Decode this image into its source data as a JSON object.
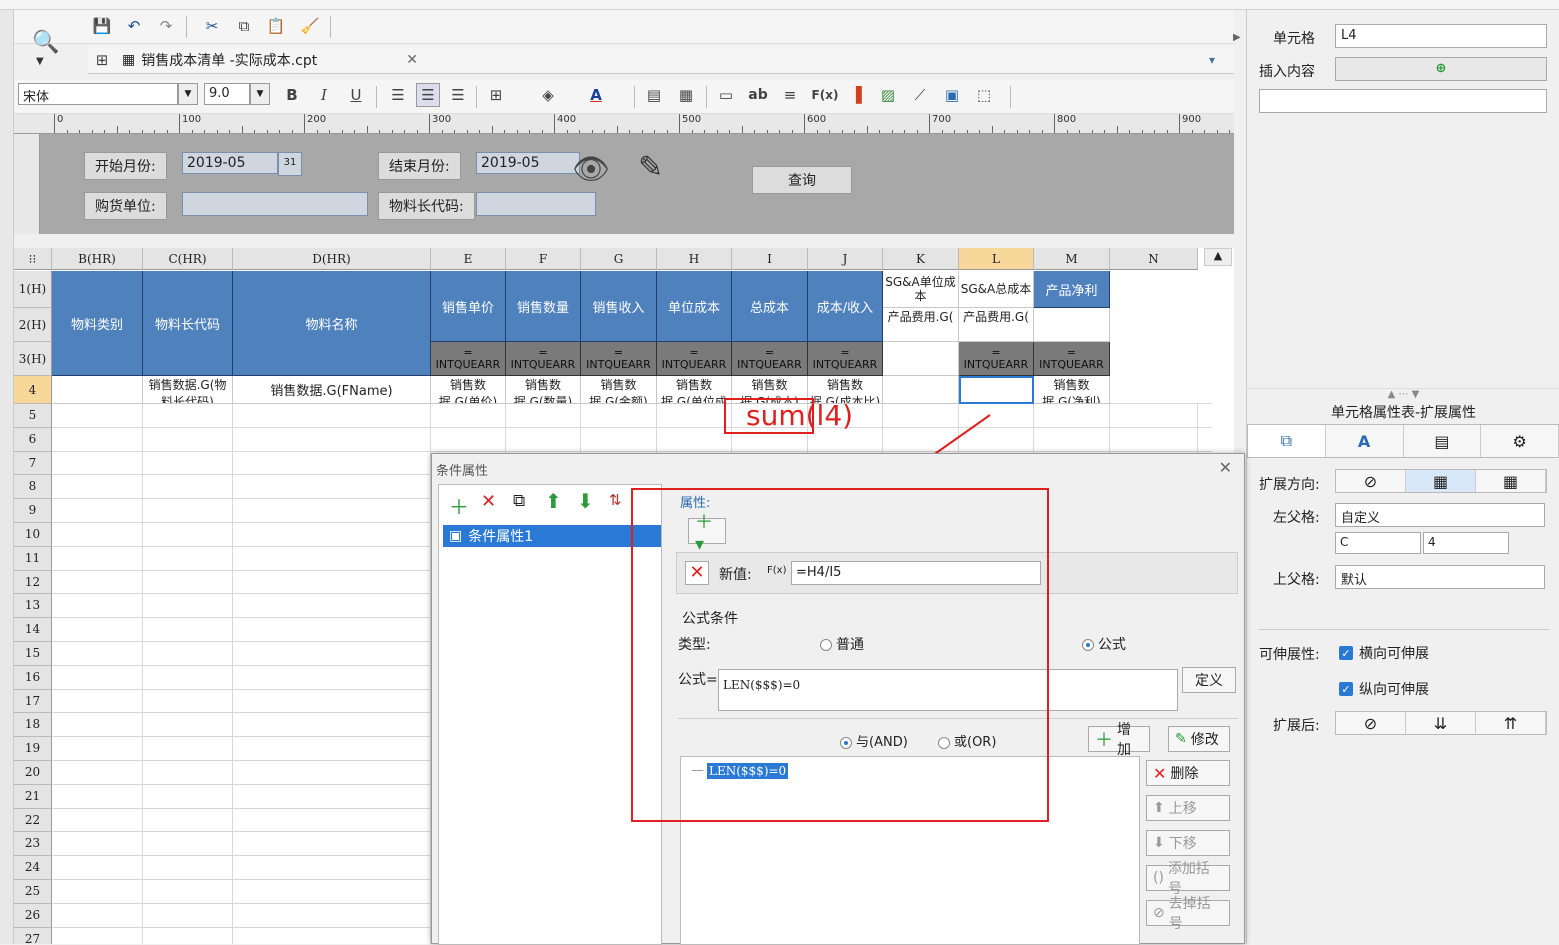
{
  "toolbar": {
    "tab_title": "销售成本清单 -实际成本.cpt",
    "font_name": "宋体",
    "font_size": "9.0",
    "bold": "B",
    "italic": "I",
    "underline": "U",
    "text_ab": "ab",
    "fx": "F(x)"
  },
  "ruler": {
    "labels": [
      "0",
      "100",
      "200",
      "300",
      "400",
      "500",
      "600",
      "700",
      "800",
      "900"
    ]
  },
  "params": {
    "start_label": "开始月份:",
    "start_value": "2019-05",
    "end_label": "结束月份:",
    "end_value": "2019-05",
    "buyer_label": "购货单位:",
    "code_label": "物料长代码:",
    "query_button": "查询",
    "calendar_day": "31"
  },
  "grid": {
    "col_headers": [
      "B(HR)",
      "C(HR)",
      "D(HR)",
      "E",
      "F",
      "G",
      "H",
      "I",
      "J",
      "K",
      "L",
      "M",
      "N"
    ],
    "row_headers": [
      "1(H)",
      "2(H)",
      "3(H)",
      "4",
      "5",
      "6",
      "7",
      "8",
      "9",
      "10",
      "11",
      "12",
      "13",
      "14",
      "15",
      "16",
      "17",
      "18",
      "19",
      "20",
      "21",
      "22",
      "23",
      "24",
      "25",
      "26",
      "27"
    ],
    "header_labels": {
      "b": "物料类别",
      "c": "物料长代码",
      "d": "物料名称",
      "e": "销售单价",
      "f": "销售数量",
      "g": "销售收入",
      "h": "单位成本",
      "i": "总成本",
      "j": "成本/收入",
      "k1": "SG&A单位成本",
      "l1": "SG&A总成本",
      "m": "产品净利",
      "k2": "产品费用.G(",
      "l2": "产品费用.G(",
      "r3": "= INTQUEARR"
    },
    "row4": {
      "c": "销售数据.G(物料长代码)",
      "d": "销售数据.G(FName)",
      "e": "销售数据.G(单价)",
      "f": "销售数据.G(数量)",
      "g": "销售数据.G(金额)",
      "h": "销售数据.G(单位成本)",
      "i": "销售数据.G(成本)",
      "j": "销售数据.G(成本比)",
      "m": "销售数据.G(净利)"
    },
    "annotation": "sum(l4)"
  },
  "right_panel": {
    "cell_label": "单元格",
    "cell_value": "L4",
    "insert_label": "插入内容",
    "props_title": "单元格属性表-扩展属性",
    "expand_dir_label": "扩展方向:",
    "left_parent_label": "左父格:",
    "left_parent_value": "自定义",
    "left_col": "C",
    "left_row": "4",
    "top_parent_label": "上父格:",
    "top_parent_value": "默认",
    "stretch_label": "可伸展性:",
    "stretch_h": "横向可伸展",
    "stretch_v": "纵向可伸展",
    "after_label": "扩展后:"
  },
  "dialog": {
    "title": "条件属性",
    "list_item": "条件属性1",
    "attr_label": "属性:",
    "new_value_label": "新值:",
    "fx_label": "F(x)",
    "new_value": "=H4/I5",
    "formula_cond_label": "公式条件",
    "type_label": "类型:",
    "type_normal": "普通",
    "type_formula": "公式",
    "formula_label": "公式=",
    "formula_value": "LEN($$$)=0",
    "define_button": "定义",
    "and_label": "与(AND)",
    "or_label": "或(OR)",
    "add_button": "增加",
    "modify_button": "修改",
    "delete_button": "删除",
    "up_button": "上移",
    "down_button": "下移",
    "add_paren_button": "添加括号",
    "remove_paren_button": "去掉括号",
    "tree_item": "LEN($$$)=0"
  },
  "colors": {
    "header_blue": "#4f81bd",
    "accent_red": "#e02020",
    "select_blue": "#2a7ad5"
  }
}
